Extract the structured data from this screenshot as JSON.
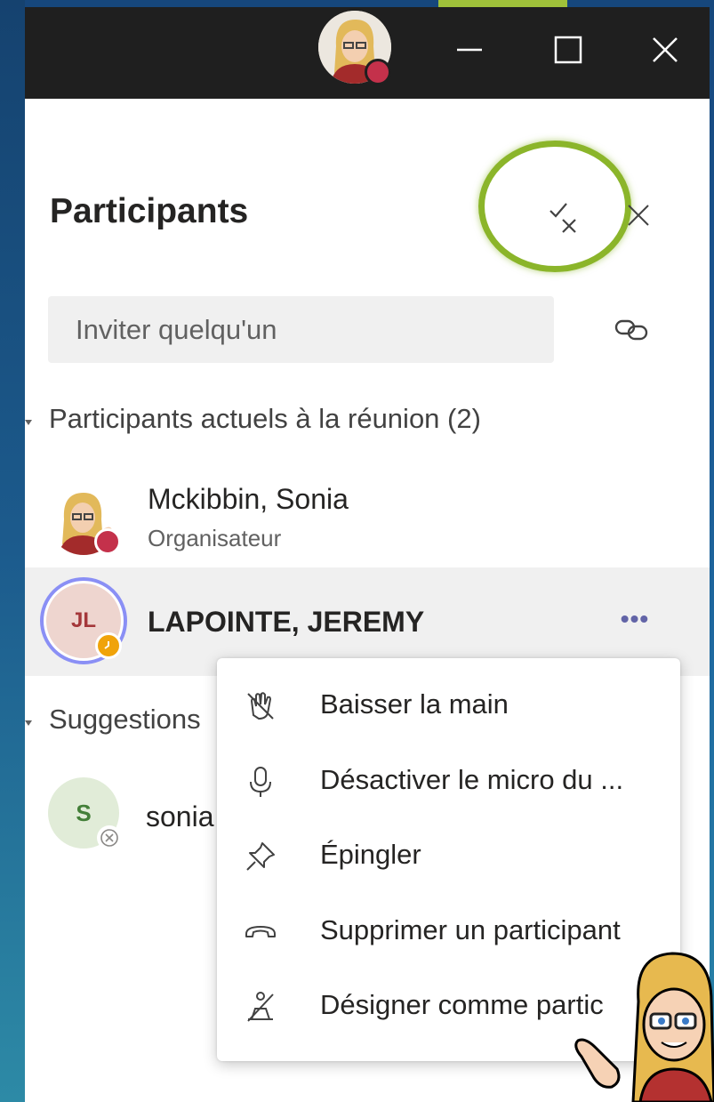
{
  "panel": {
    "title": "Participants",
    "invite_placeholder": "Inviter quelqu'un"
  },
  "sections": {
    "current_label": "Participants actuels à la réunion (2)",
    "suggestions_label": "Suggestions"
  },
  "participants": [
    {
      "name": "Mckibbin, Sonia",
      "role": "Organisateur",
      "status": "busy",
      "status_color": "#c4314b"
    },
    {
      "name": "LAPOINTE, JEREMY",
      "initials": "JL",
      "status": "away",
      "status_color": "#f0a30a",
      "more": "•••"
    }
  ],
  "suggestions": [
    {
      "name_visible": "sonia",
      "initials": "S",
      "status": "offline"
    }
  ],
  "context_menu": [
    {
      "icon": "lower-hand-icon",
      "label": "Baisser la main"
    },
    {
      "icon": "microphone-icon",
      "label": "Désactiver le micro du ..."
    },
    {
      "icon": "pin-icon",
      "label": "Épingler"
    },
    {
      "icon": "hang-up-icon",
      "label": "Supprimer un participant"
    },
    {
      "icon": "designate-attendee-icon",
      "label": "Désigner comme partic"
    }
  ],
  "colors": {
    "accent": "#6264a7",
    "highlight_ring": "#8bb52a",
    "titlebar": "#1f1f1f",
    "busy": "#c4314b",
    "away": "#f0a30a"
  }
}
